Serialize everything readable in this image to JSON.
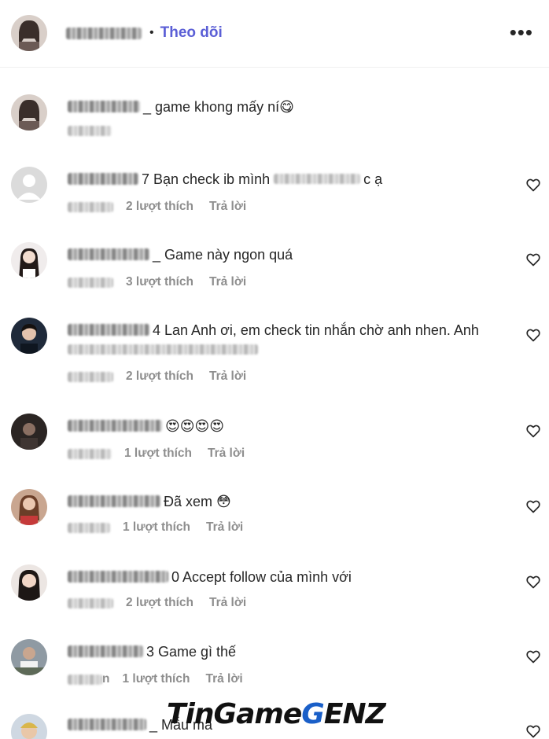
{
  "header": {
    "dot": "•",
    "follow_label": "Theo dõi",
    "more_label": "•••"
  },
  "comments": [
    {
      "text": "_ game khong mấy ní",
      "emoji": "😋",
      "likes": "",
      "reply": ""
    },
    {
      "text": "7 Bạn check ib mình",
      "tail": "c ạ",
      "likes": "2 lượt thích",
      "reply": "Trả lời"
    },
    {
      "text": "_ Game này ngon quá",
      "likes": "3 lượt thích",
      "reply": "Trả lời"
    },
    {
      "text": "4 Lan Anh ơi, em check tin nhắn chờ anh nhen. Anh",
      "likes": "2 lượt thích",
      "reply": "Trả lời"
    },
    {
      "text": "",
      "emoji": "😍😍😍😍",
      "likes": "1 lượt thích",
      "reply": "Trả lời"
    },
    {
      "text": "Đã xem",
      "emoji": "😳",
      "likes": "1 lượt thích",
      "reply": "Trả lời"
    },
    {
      "text": "0 Accept follow của mình với",
      "likes": "2 lượt thích",
      "reply": "Trả lời"
    },
    {
      "text": "3 Game gì thế",
      "time_tail": "n",
      "likes": "1 lượt thích",
      "reply": "Trả lời"
    },
    {
      "text": "_ Mẫu mã",
      "likes": "",
      "reply": ""
    }
  ],
  "watermark": {
    "part1": "TinGame",
    "part2": "G",
    "part3": "ENZ"
  },
  "colors": {
    "follow": "#5b5fd6",
    "meta": "#8e8e8e",
    "text": "#262626"
  }
}
